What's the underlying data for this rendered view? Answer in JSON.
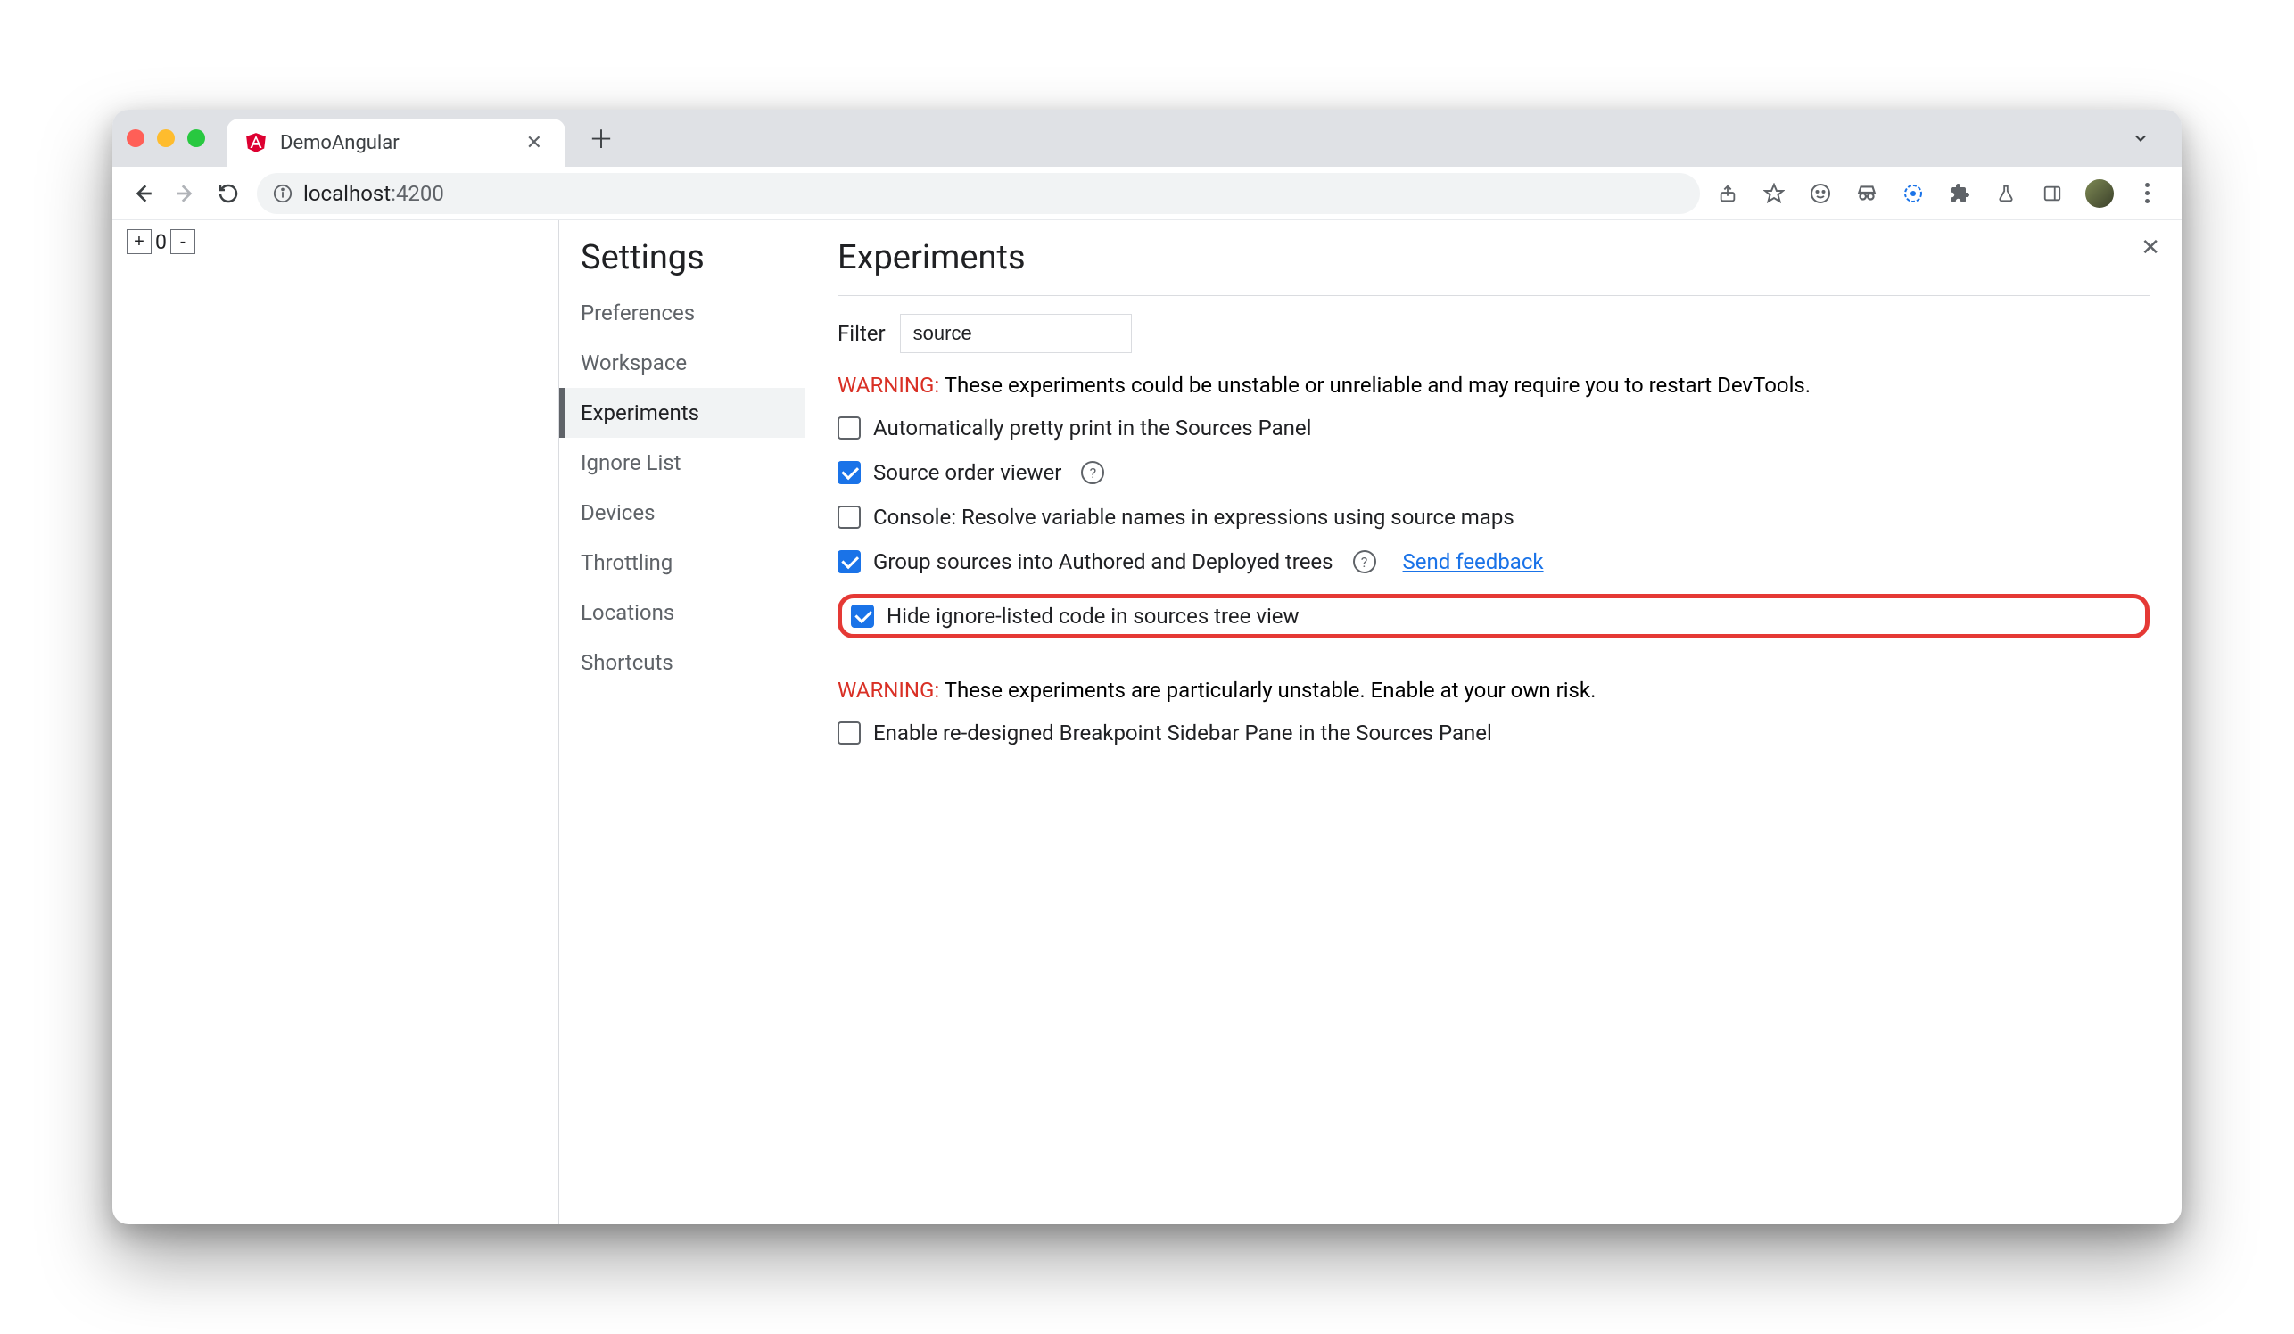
{
  "browser": {
    "tab_title": "DemoAngular",
    "url_host": "localhost",
    "url_port": ":4200"
  },
  "page": {
    "plus": "+",
    "count": "0",
    "minus": "-"
  },
  "settings": {
    "heading": "Settings",
    "items": [
      {
        "label": "Preferences"
      },
      {
        "label": "Workspace"
      },
      {
        "label": "Experiments"
      },
      {
        "label": "Ignore List"
      },
      {
        "label": "Devices"
      },
      {
        "label": "Throttling"
      },
      {
        "label": "Locations"
      },
      {
        "label": "Shortcuts"
      }
    ]
  },
  "experiments": {
    "title": "Experiments",
    "filter_label": "Filter",
    "filter_value": "source",
    "warning1_prefix": "WARNING:",
    "warning1_text": " These experiments could be unstable or unreliable and may require you to restart DevTools.",
    "items": [
      {
        "label": "Automatically pretty print in the Sources Panel",
        "checked": false,
        "help": false
      },
      {
        "label": "Source order viewer",
        "checked": true,
        "help": true
      },
      {
        "label": "Console: Resolve variable names in expressions using source maps",
        "checked": false,
        "help": false
      },
      {
        "label": "Group sources into Authored and Deployed trees",
        "checked": true,
        "help": true,
        "feedback": true
      },
      {
        "label": "Hide ignore-listed code in sources tree view",
        "checked": true,
        "help": false,
        "highlight": true
      }
    ],
    "feedback_label": "Send feedback",
    "warning2_prefix": "WARNING:",
    "warning2_text": " These experiments are particularly unstable. Enable at your own risk.",
    "items2": [
      {
        "label": "Enable re-designed Breakpoint Sidebar Pane in the Sources Panel",
        "checked": false
      }
    ]
  }
}
